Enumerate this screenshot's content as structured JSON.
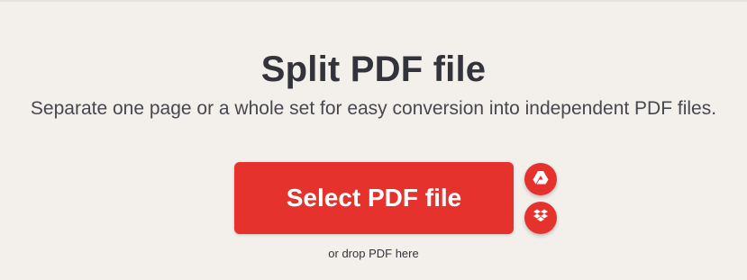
{
  "header": {
    "title": "Split PDF file",
    "subtitle": "Separate one page or a whole set for easy conversion into independent PDF files."
  },
  "upload": {
    "select_label": "Select PDF file",
    "drop_hint": "or drop PDF here",
    "cloud_sources": [
      {
        "name": "google-drive",
        "icon": "google-drive-icon"
      },
      {
        "name": "dropbox",
        "icon": "dropbox-icon"
      }
    ]
  },
  "colors": {
    "accent": "#e5322d",
    "background": "#f3f0ec",
    "text": "#33333b"
  }
}
